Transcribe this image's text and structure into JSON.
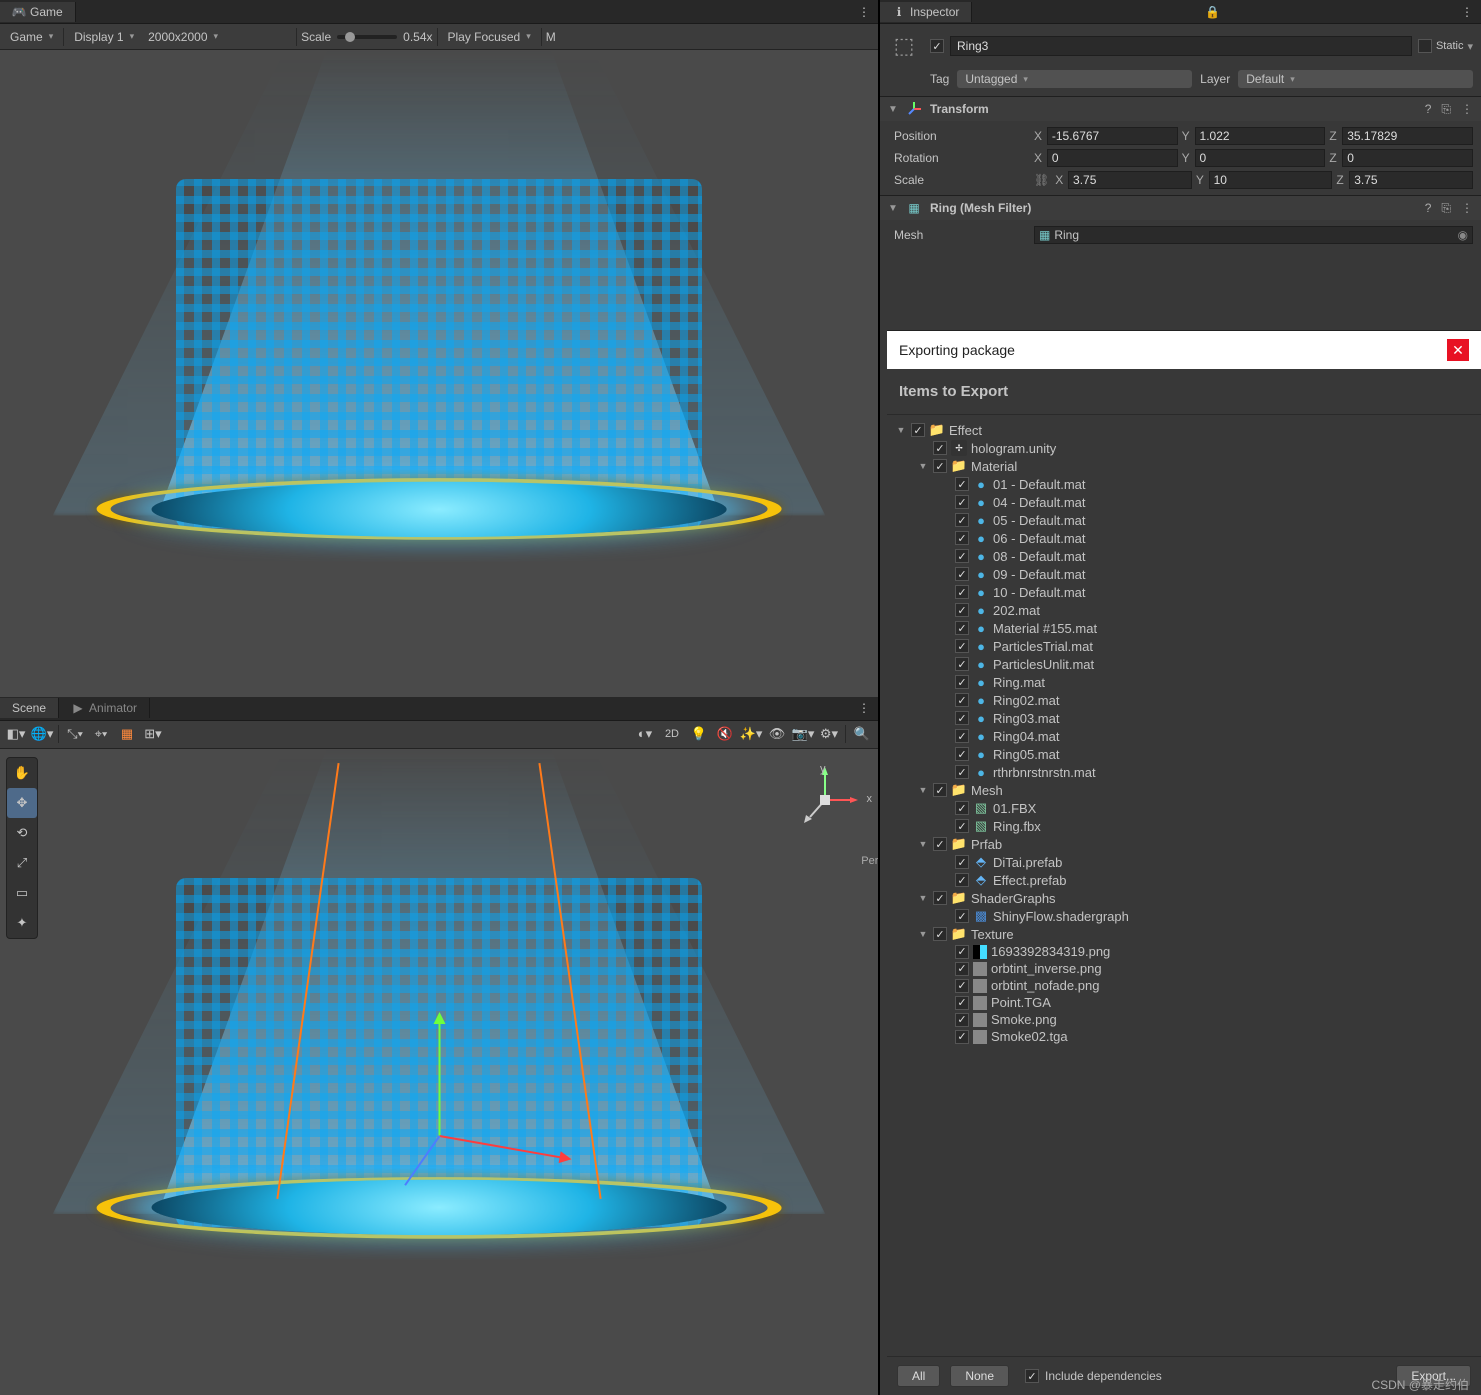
{
  "game": {
    "tab_label": "Game",
    "mode": "Game",
    "display": "Display 1",
    "resolution": "2000x2000",
    "scale_label": "Scale",
    "scale_value": "0.54x",
    "focus_mode": "Play Focused",
    "extra": "M"
  },
  "scene": {
    "tab_scene": "Scene",
    "tab_animator": "Animator",
    "btn_2d": "2D",
    "persp_label": "Persp",
    "axis_x": "x",
    "axis_y": "y"
  },
  "inspector": {
    "tab_label": "Inspector",
    "active": true,
    "name": "Ring3",
    "static_label": "Static",
    "tag_label": "Tag",
    "tag_value": "Untagged",
    "layer_label": "Layer",
    "layer_value": "Default",
    "transform": {
      "title": "Transform",
      "position_label": "Position",
      "rotation_label": "Rotation",
      "scale_label": "Scale",
      "pos": {
        "x": "-15.6767",
        "y": "1.022",
        "z": "35.17829"
      },
      "rot": {
        "x": "0",
        "y": "0",
        "z": "0"
      },
      "scale": {
        "x": "3.75",
        "y": "10",
        "z": "3.75"
      }
    },
    "mesh_filter": {
      "title": "Ring (Mesh Filter)",
      "mesh_label": "Mesh",
      "mesh_value": "Ring"
    }
  },
  "export": {
    "title": "Exporting package",
    "items_label": "Items to Export",
    "all_btn": "All",
    "none_btn": "None",
    "include_deps": "Include dependencies",
    "export_btn": "Export...",
    "tree": [
      {
        "depth": 0,
        "fold": "▼",
        "icon": "folder",
        "name": "Effect"
      },
      {
        "depth": 1,
        "fold": "",
        "icon": "unity",
        "name": "hologram.unity"
      },
      {
        "depth": 1,
        "fold": "▼",
        "icon": "folder",
        "name": "Material"
      },
      {
        "depth": 2,
        "fold": "",
        "icon": "mat",
        "name": "01 - Default.mat"
      },
      {
        "depth": 2,
        "fold": "",
        "icon": "mat",
        "name": "04 - Default.mat"
      },
      {
        "depth": 2,
        "fold": "",
        "icon": "mat",
        "name": "05 - Default.mat"
      },
      {
        "depth": 2,
        "fold": "",
        "icon": "mat",
        "name": "06 - Default.mat"
      },
      {
        "depth": 2,
        "fold": "",
        "icon": "mat",
        "name": "08 - Default.mat"
      },
      {
        "depth": 2,
        "fold": "",
        "icon": "mat",
        "name": "09 - Default.mat"
      },
      {
        "depth": 2,
        "fold": "",
        "icon": "mat",
        "name": "10 - Default.mat"
      },
      {
        "depth": 2,
        "fold": "",
        "icon": "mat",
        "name": "202.mat"
      },
      {
        "depth": 2,
        "fold": "",
        "icon": "mat",
        "name": "Material #155.mat"
      },
      {
        "depth": 2,
        "fold": "",
        "icon": "mat",
        "name": "ParticlesTrial.mat"
      },
      {
        "depth": 2,
        "fold": "",
        "icon": "mat",
        "name": "ParticlesUnlit.mat"
      },
      {
        "depth": 2,
        "fold": "",
        "icon": "mat",
        "name": "Ring.mat"
      },
      {
        "depth": 2,
        "fold": "",
        "icon": "mat",
        "name": "Ring02.mat"
      },
      {
        "depth": 2,
        "fold": "",
        "icon": "mat",
        "name": "Ring03.mat"
      },
      {
        "depth": 2,
        "fold": "",
        "icon": "mat",
        "name": "Ring04.mat"
      },
      {
        "depth": 2,
        "fold": "",
        "icon": "mat",
        "name": "Ring05.mat"
      },
      {
        "depth": 2,
        "fold": "",
        "icon": "mat",
        "name": "rthrbnrstnrstn.mat"
      },
      {
        "depth": 1,
        "fold": "▼",
        "icon": "folder",
        "name": "Mesh"
      },
      {
        "depth": 2,
        "fold": "",
        "icon": "mesh",
        "name": "01.FBX"
      },
      {
        "depth": 2,
        "fold": "",
        "icon": "mesh",
        "name": "Ring.fbx"
      },
      {
        "depth": 1,
        "fold": "▼",
        "icon": "folder",
        "name": "Prfab"
      },
      {
        "depth": 2,
        "fold": "",
        "icon": "prefab",
        "name": "DiTai.prefab"
      },
      {
        "depth": 2,
        "fold": "",
        "icon": "prefab",
        "name": "Effect.prefab"
      },
      {
        "depth": 1,
        "fold": "▼",
        "icon": "folder",
        "name": "ShaderGraphs"
      },
      {
        "depth": 2,
        "fold": "",
        "icon": "shader",
        "name": "ShinyFlow.shadergraph"
      },
      {
        "depth": 1,
        "fold": "▼",
        "icon": "folder",
        "name": "Texture"
      },
      {
        "depth": 2,
        "fold": "",
        "icon": "texblue",
        "name": "1693392834319.png"
      },
      {
        "depth": 2,
        "fold": "",
        "icon": "tex",
        "name": "orbtint_inverse.png"
      },
      {
        "depth": 2,
        "fold": "",
        "icon": "tex",
        "name": "orbtint_nofade.png"
      },
      {
        "depth": 2,
        "fold": "",
        "icon": "tex",
        "name": "Point.TGA"
      },
      {
        "depth": 2,
        "fold": "",
        "icon": "tex",
        "name": "Smoke.png"
      },
      {
        "depth": 2,
        "fold": "",
        "icon": "tex",
        "name": "Smoke02.tga"
      }
    ]
  },
  "watermark": "CSDN @暴走约伯"
}
